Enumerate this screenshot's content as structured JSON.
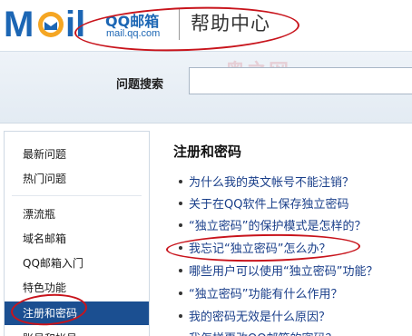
{
  "header": {
    "logo_mail": "Mail",
    "logo_qq": "QQ邮箱",
    "logo_domain": "mail.qq.com",
    "help_title": "帮助中心"
  },
  "search": {
    "label": "问题搜索",
    "value": ""
  },
  "watermark": "奥之网",
  "sidebar": {
    "items": [
      {
        "label": "最新问题",
        "active": false
      },
      {
        "label": "热门问题",
        "active": false
      },
      {
        "label": "漂流瓶",
        "active": false
      },
      {
        "label": "域名邮箱",
        "active": false
      },
      {
        "label": "QQ邮箱入门",
        "active": false
      },
      {
        "label": "特色功能",
        "active": false
      },
      {
        "label": "注册和密码",
        "active": true
      },
      {
        "label": "账号和帐号",
        "active": false
      }
    ]
  },
  "main": {
    "title": "注册和密码",
    "questions": [
      "为什么我的英文帐号不能注销？",
      "关于在QQ软件上保存独立密码",
      "“独立密码”的保护模式是怎样的？",
      "我忘记“独立密码”怎么办？",
      "哪些用户可以使用“独立密码”功能？",
      "“独立密码”功能有什么作用？",
      "我的密码无效是什么原因？",
      "我怎样更改QQ邮箱的密码？"
    ]
  },
  "colors": {
    "accent": "#1b4f91",
    "link": "#1a3f8a",
    "annotation": "#c8141c"
  }
}
